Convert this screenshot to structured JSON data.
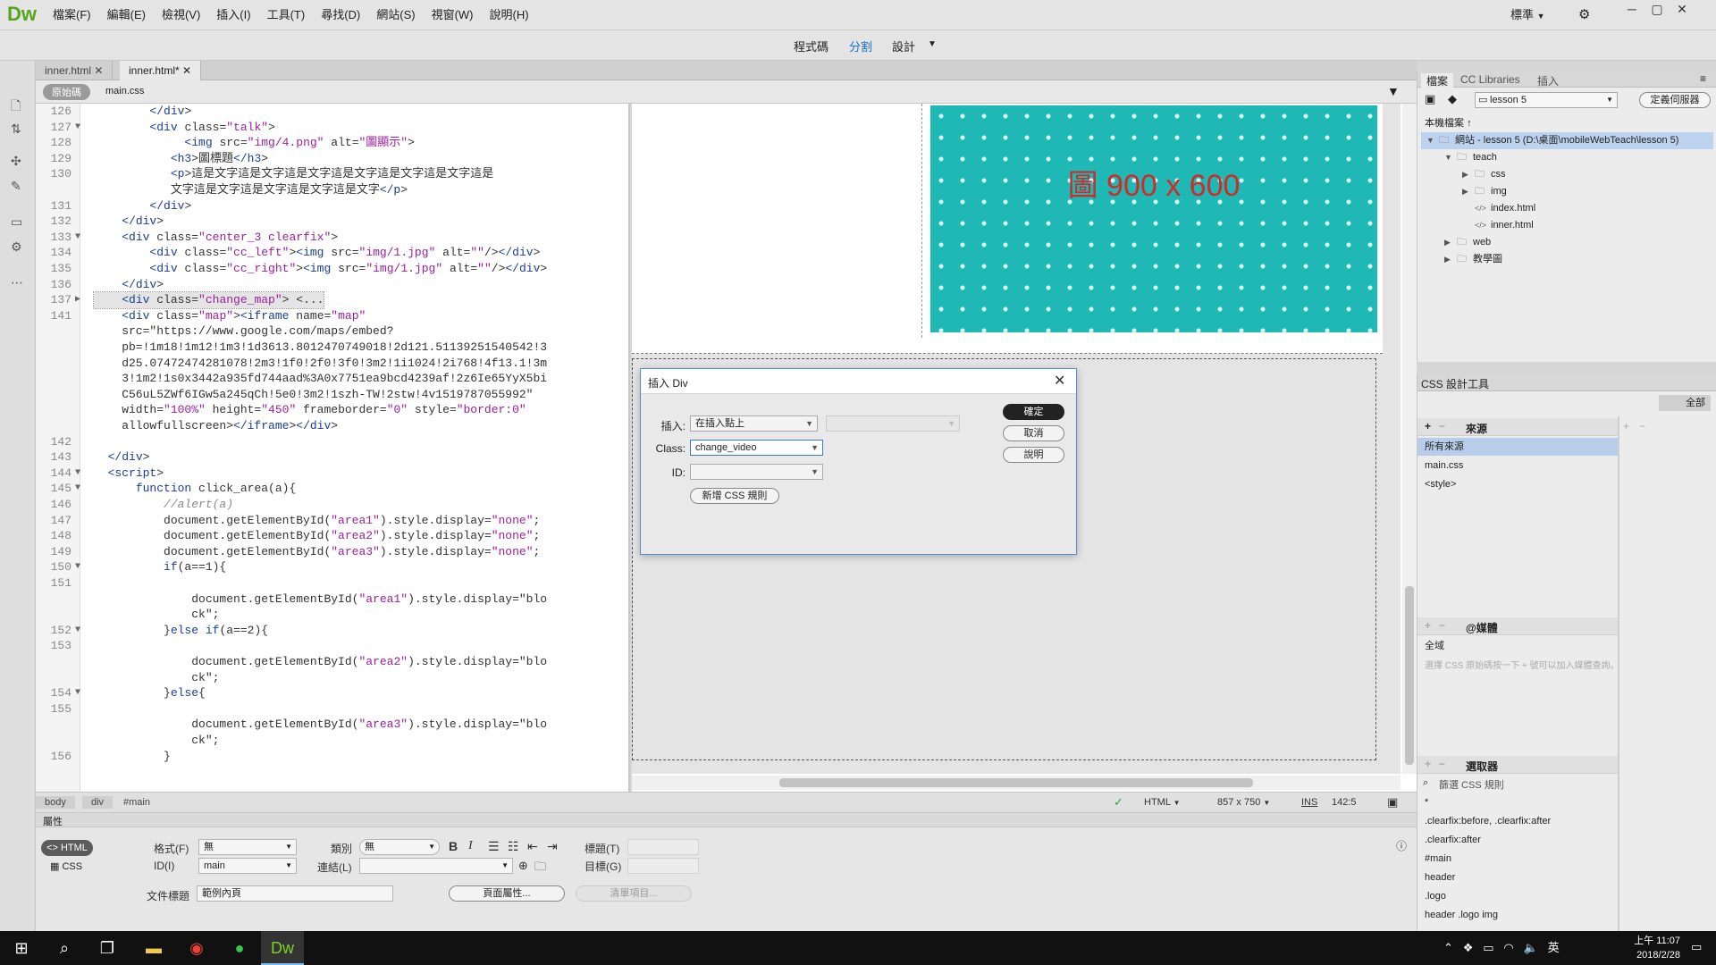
{
  "app": {
    "logo": "Dw",
    "menu": [
      "檔案(F)",
      "編輯(E)",
      "檢視(V)",
      "插入(I)",
      "工具(T)",
      "尋找(D)",
      "網站(S)",
      "視窗(W)",
      "說明(H)"
    ],
    "workspace": "標準",
    "views": {
      "code": "程式碼",
      "split": "分割",
      "design": "設計"
    }
  },
  "doc": {
    "tabs": [
      "inner.html",
      "inner.html*"
    ],
    "related": {
      "source": "原始碼",
      "css": "main.css"
    }
  },
  "code_lines": [
    {
      "n": "126",
      "f": "",
      "t": "        </div>"
    },
    {
      "n": "127",
      "f": "▼",
      "t": "        <div class=\"talk\">"
    },
    {
      "n": "128",
      "f": "",
      "t": "             <img src=\"img/4.png\" alt=\"圖顯示\">"
    },
    {
      "n": "129",
      "f": "",
      "t": "           <h3>圖標題</h3>"
    },
    {
      "n": "130",
      "f": "",
      "t": "           <p>這是文字這是文字這是文字這是文字這是文字這是文字這是"
    },
    {
      "n": "",
      "f": "",
      "t": "           文字這是文字這是文字這是文字這是文字</p>"
    },
    {
      "n": "131",
      "f": "",
      "t": "        </div>"
    },
    {
      "n": "132",
      "f": "",
      "t": "    </div>"
    },
    {
      "n": "133",
      "f": "▼",
      "t": "    <div class=\"center_3 clearfix\">"
    },
    {
      "n": "134",
      "f": "",
      "t": "        <div class=\"cc_left\"><img src=\"img/1.jpg\" alt=\"\"/></div>"
    },
    {
      "n": "135",
      "f": "",
      "t": "        <div class=\"cc_right\"><img src=\"img/1.jpg\" alt=\"\"/></div>"
    },
    {
      "n": "136",
      "f": "",
      "t": "    </div>"
    },
    {
      "n": "137",
      "f": "▶",
      "t": "    <div class=\"change_map\"> <..."
    },
    {
      "n": "141",
      "f": "",
      "t": "    <div class=\"map\"><iframe name=\"map\""
    },
    {
      "n": "",
      "f": "",
      "t": "    src=\"https://www.google.com/maps/embed?"
    },
    {
      "n": "",
      "f": "",
      "t": "    pb=!1m18!1m12!1m3!1d3613.8012470749018!2d121.51139251540542!3"
    },
    {
      "n": "",
      "f": "",
      "t": "    d25.07472474281078!2m3!1f0!2f0!3f0!3m2!1i1024!2i768!4f13.1!3m"
    },
    {
      "n": "",
      "f": "",
      "t": "    3!1m2!1s0x3442a935fd744aad%3A0x7751ea9bcd4239af!2z6Ie65YyX5bi"
    },
    {
      "n": "",
      "f": "",
      "t": "    C56uL5ZWf6IGw5a245qCh!5e0!3m2!1szh-TW!2stw!4v1519787055992\""
    },
    {
      "n": "",
      "f": "",
      "t": "    width=\"100%\" height=\"450\" frameborder=\"0\" style=\"border:0\""
    },
    {
      "n": "",
      "f": "",
      "t": "    allowfullscreen></iframe></div>"
    },
    {
      "n": "142",
      "f": "",
      "t": ""
    },
    {
      "n": "143",
      "f": "",
      "t": "  </div>"
    },
    {
      "n": "144",
      "f": "▼",
      "t": "  <script>"
    },
    {
      "n": "145",
      "f": "▼",
      "t": "      function click_area(a){"
    },
    {
      "n": "146",
      "f": "",
      "t": "          //alert(a)"
    },
    {
      "n": "147",
      "f": "",
      "t": "          document.getElementById(\"area1\").style.display=\"none\";"
    },
    {
      "n": "148",
      "f": "",
      "t": "          document.getElementById(\"area2\").style.display=\"none\";"
    },
    {
      "n": "149",
      "f": "",
      "t": "          document.getElementById(\"area3\").style.display=\"none\";"
    },
    {
      "n": "150",
      "f": "▼",
      "t": "          if(a==1){"
    },
    {
      "n": "151",
      "f": "",
      "t": ""
    },
    {
      "n": "",
      "f": "",
      "t": "              document.getElementById(\"area1\").style.display=\"blo"
    },
    {
      "n": "",
      "f": "",
      "t": "              ck\";"
    },
    {
      "n": "152",
      "f": "▼",
      "t": "          }else if(a==2){"
    },
    {
      "n": "153",
      "f": "",
      "t": ""
    },
    {
      "n": "",
      "f": "",
      "t": "              document.getElementById(\"area2\").style.display=\"blo"
    },
    {
      "n": "",
      "f": "",
      "t": "              ck\";"
    },
    {
      "n": "154",
      "f": "▼",
      "t": "          }else{"
    },
    {
      "n": "155",
      "f": "",
      "t": ""
    },
    {
      "n": "",
      "f": "",
      "t": "              document.getElementById(\"area3\").style.display=\"blo"
    },
    {
      "n": "",
      "f": "",
      "t": "              ck\";"
    },
    {
      "n": "156",
      "f": "",
      "t": "          }"
    }
  ],
  "design": {
    "image_label": "圖 900 x 600"
  },
  "dialog": {
    "title": "插入 Div",
    "insert_label": "插入:",
    "insert_value": "在插入點上",
    "class_label": "Class:",
    "class_value": "change_video",
    "id_label": "ID:",
    "id_value": "",
    "new_css_rule": "新增 CSS 規則",
    "ok": "確定",
    "cancel": "取消",
    "help": "說明"
  },
  "status": {
    "crumbs": [
      "body",
      "div",
      "#main"
    ],
    "doctype": "HTML",
    "size": "857 x 750",
    "mode": "INS",
    "position": "142:5"
  },
  "properties": {
    "title": "屬性",
    "html_btn": "HTML",
    "css_btn": "CSS",
    "format_label": "格式(F)",
    "format_value": "無",
    "class_label": "類別",
    "class_value": "無",
    "id_label": "ID(I)",
    "id_value": "main",
    "link_label": "連結(L)",
    "link_value": "",
    "heading_label": "標題(T)",
    "target_label": "目標(G)",
    "doc_title_label": "文件標題",
    "doc_title_value": "範例內頁",
    "page_props": "頁面屬性...",
    "list_item": "清單項目..."
  },
  "files_panel": {
    "tabs": [
      "檔案",
      "CC Libraries",
      "插入"
    ],
    "site": "lesson 5",
    "define_server": "定義伺服器",
    "local_files": "本機檔案",
    "tree": [
      {
        "label": "網站 - lesson 5 (D:\\桌面\\mobileWebTeach\\lesson 5)",
        "depth": 0,
        "tw": "▼",
        "icon": "folder",
        "selected": true
      },
      {
        "label": "teach",
        "depth": 1,
        "tw": "▼",
        "icon": "folder",
        "selected": false
      },
      {
        "label": "css",
        "depth": 2,
        "tw": "▶",
        "icon": "folder",
        "selected": false
      },
      {
        "label": "img",
        "depth": 2,
        "tw": "▶",
        "icon": "folder",
        "selected": false
      },
      {
        "label": "index.html",
        "depth": 2,
        "tw": "",
        "icon": "code",
        "selected": false
      },
      {
        "label": "inner.html",
        "depth": 2,
        "tw": "",
        "icon": "code",
        "selected": false
      },
      {
        "label": "web",
        "depth": 1,
        "tw": "▶",
        "icon": "folder",
        "selected": false
      },
      {
        "label": "教學圖",
        "depth": 1,
        "tw": "▶",
        "icon": "folder",
        "selected": false
      }
    ]
  },
  "css_panel": {
    "title": "CSS 設計工具",
    "all_btn": "全部",
    "sources_title": "來源",
    "sources": [
      "所有來源",
      "main.css",
      "<style>"
    ],
    "media_title": "@媒體",
    "media_global": "全域",
    "media_hint": "選擇 CSS 原始碼按一下 + 號可以加入媒體查詢。",
    "selectors_title": "選取器",
    "selectors_filter": "篩選 CSS 規則",
    "selectors": [
      "*",
      ".clearfix:before, .clearfix:after",
      ".clearfix:after",
      "#main",
      "header",
      ".logo",
      "header .logo img"
    ]
  },
  "taskbar": {
    "tray_lang": "英",
    "time": "上午 11:07",
    "date": "2018/2/28"
  }
}
